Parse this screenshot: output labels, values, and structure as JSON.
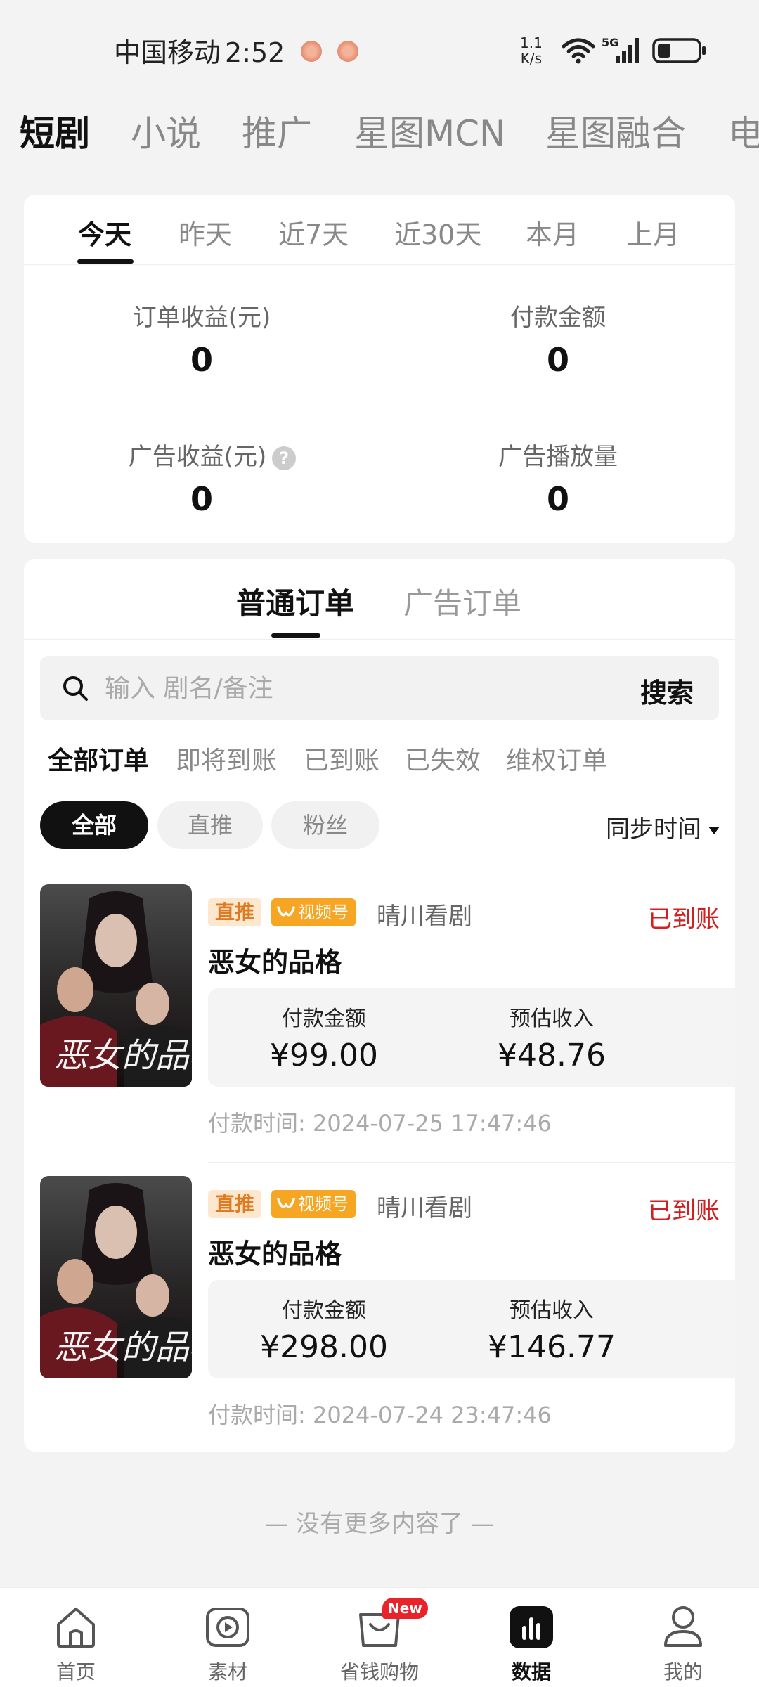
{
  "status_bar": {
    "carrier": "中国移动",
    "time": "2:52",
    "net_speed_value": "1.1",
    "net_speed_unit": "K/s",
    "network": "5G"
  },
  "top_tabs": [
    "短剧",
    "小说",
    "推广",
    "星图MCN",
    "星图融合",
    "电"
  ],
  "period_tabs": [
    "今天",
    "昨天",
    "近7天",
    "近30天",
    "本月",
    "上月"
  ],
  "stats": {
    "order_income_label": "订单收益(元)",
    "order_income_value": "0",
    "pay_amount_label": "付款金额",
    "pay_amount_value": "0",
    "ad_income_label": "广告收益(元)",
    "ad_income_value": "0",
    "ad_plays_label": "广告播放量",
    "ad_plays_value": "0",
    "help_glyph": "?"
  },
  "order_tabs": [
    "普通订单",
    "广告订单"
  ],
  "search": {
    "placeholder": "输入 剧名/备注",
    "button": "搜索"
  },
  "status_filters": [
    "全部订单",
    "即将到账",
    "已到账",
    "已失效",
    "维权订单"
  ],
  "chips": [
    "全部",
    "直推",
    "粉丝"
  ],
  "sort_label": "同步时间",
  "orders": [
    {
      "tag": "直推",
      "platform": "视频号",
      "channel": "晴川看剧",
      "status": "已到账",
      "title": "恶女的品格",
      "pay_label": "付款金额",
      "pay_value": "¥99.00",
      "income_label": "预估收入",
      "income_value": "¥48.76",
      "pay_time": "付款时间:  2024-07-25 17:47:46"
    },
    {
      "tag": "直推",
      "platform": "视频号",
      "channel": "晴川看剧",
      "status": "已到账",
      "title": "恶女的品格",
      "pay_label": "付款金额",
      "pay_value": "¥298.00",
      "income_label": "预估收入",
      "income_value": "¥146.77",
      "pay_time": "付款时间:  2024-07-24 23:47:46"
    }
  ],
  "poster_text": "恶女的品格",
  "no_more": "— 没有更多内容了 —",
  "bottom_nav": {
    "items": [
      "首页",
      "素材",
      "省钱购物",
      "数据",
      "我的"
    ],
    "new_badge": "New"
  },
  "colors": {
    "accent": "#111111",
    "status_arrived": "#d02020",
    "tag_zhitui_bg": "#fde8cf",
    "tag_video_bg": "#f6a623",
    "badge_new": "#e8232a"
  }
}
